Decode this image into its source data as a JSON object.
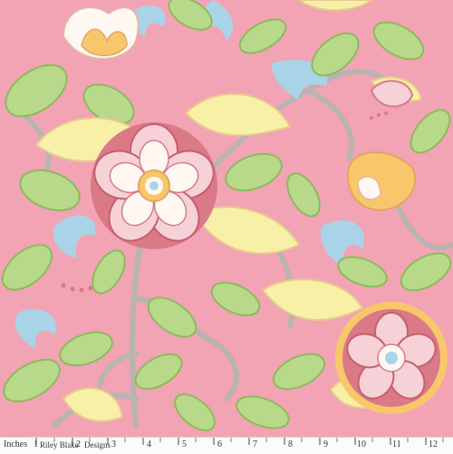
{
  "colors": {
    "background": "#f2a3b4",
    "leaf_green": "#b9d98a",
    "leaf_outline": "#8dba5e",
    "pale_yellow": "#f7f0a6",
    "flower_rose": "#d97a86",
    "flower_light": "#f6d2d8",
    "cream": "#fff8f2",
    "blue_swirl": "#a9d3e7",
    "gray_vine": "#b9b4b0",
    "orange_bud": "#f9c76b"
  },
  "ruler": {
    "unit_label": "Inches",
    "number_1": "1",
    "brand": "Riley Blake",
    "number_2": "2",
    "brand_suffix": "Designs",
    "numbers": [
      "3",
      "4",
      "5",
      "6",
      "7",
      "8",
      "9",
      "10",
      "11",
      "12"
    ]
  }
}
